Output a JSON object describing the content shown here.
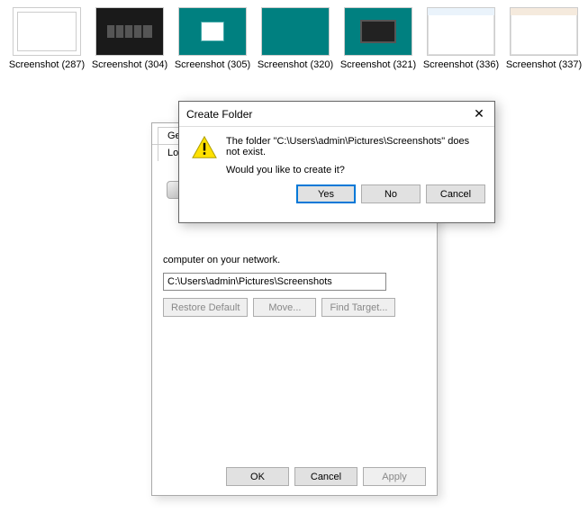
{
  "thumbnails": [
    {
      "label": "Screenshot (287)"
    },
    {
      "label": "Screenshot (304)"
    },
    {
      "label": "Screenshot (305)"
    },
    {
      "label": "Screenshot (320)"
    },
    {
      "label": "Screenshot (321)"
    },
    {
      "label": "Screenshot (336)"
    },
    {
      "label": "Screenshot (337)"
    }
  ],
  "properties_dialog": {
    "tabs": {
      "partial1": "Gen",
      "partial2": "Loc"
    },
    "help_text": "computer on your network.",
    "path_value": "C:\\Users\\admin\\Pictures\\Screenshots",
    "buttons": {
      "restore": "Restore Default",
      "move": "Move...",
      "find_target": "Find Target..."
    },
    "footer": {
      "ok": "OK",
      "cancel": "Cancel",
      "apply": "Apply"
    }
  },
  "create_dialog": {
    "title": "Create Folder",
    "close": "✕",
    "message1": "The folder \"C:\\Users\\admin\\Pictures\\Screenshots\" does not exist.",
    "message2": "Would you like to create it?",
    "buttons": {
      "yes": "Yes",
      "no": "No",
      "cancel": "Cancel"
    }
  }
}
